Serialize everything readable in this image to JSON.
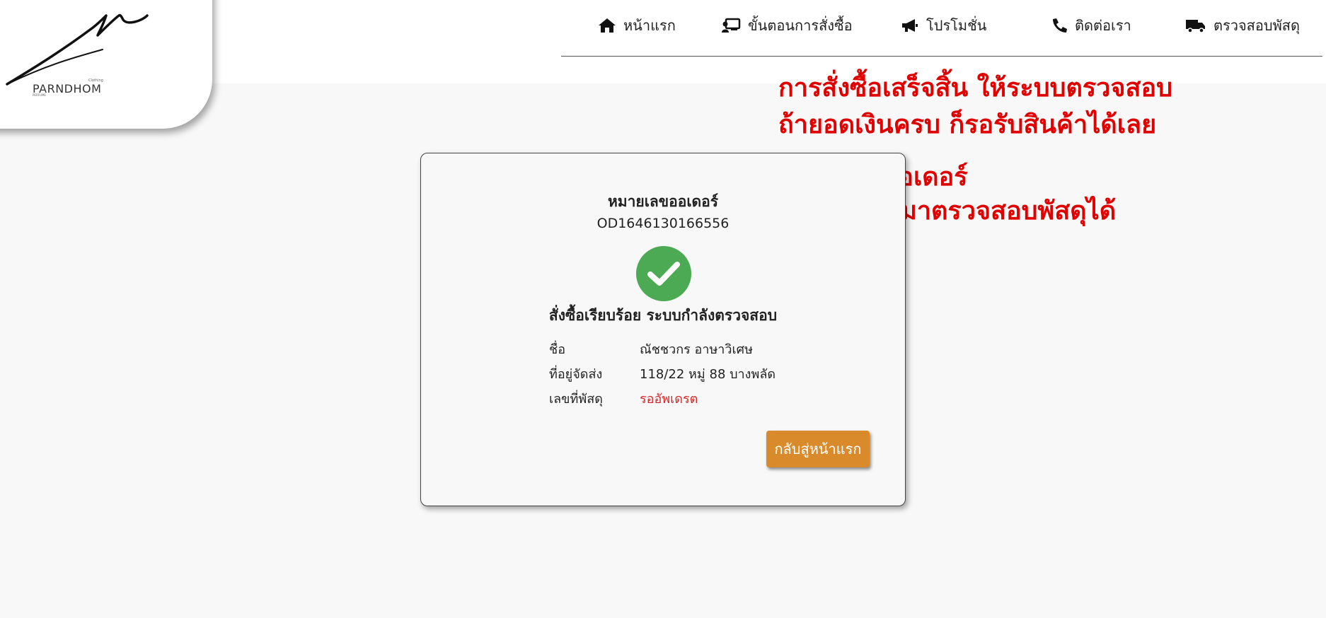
{
  "logo": {
    "brand": "PARNDHOM",
    "tagline_small": "Clothing",
    "sub_small": "PERFUME"
  },
  "nav": {
    "items": [
      {
        "label": "หน้าแรก",
        "icon": "home-icon"
      },
      {
        "label": "ขั้นตอนการสั่งซื้อ",
        "icon": "order-steps-icon"
      },
      {
        "label": "โปรโมชั่น",
        "icon": "megaphone-icon"
      },
      {
        "label": "ติดต่อเรา",
        "icon": "phone-icon"
      },
      {
        "label": "ตรวจสอบพัสดุ",
        "icon": "truck-icon"
      }
    ]
  },
  "annotation": {
    "line1": "การสั่งซื้อเสร็จสิ้น ให้ระบบตรวจสอบ",
    "line2": "ถ้ายอดเงินครบ ก็รอรับสินค้าได้เลย",
    "line3": "หมายเลขออเดอร์",
    "line4": "สามารถนำมาตรวจสอบพัสดุได้",
    "color": "#e00000"
  },
  "order": {
    "label": "หมายเลขออเดอร์",
    "number": "OD1646130166556",
    "status_icon": "check-circle-icon",
    "status_color": "#4caa54",
    "status_text": "สั่งซื้อเรียบร้อย ระบบกำลังตรวจสอบ",
    "details": [
      {
        "label": "ชื่อ",
        "value": "ณัชชวกร อาษาวิเศษ"
      },
      {
        "label": "ที่อยู่จัดส่ง",
        "value": "118/22 หมู่ 88 บางพลัด"
      },
      {
        "label": "เลขที่พัสดุ",
        "value": "รออัพเดรต"
      }
    ],
    "home_button": "กลับสู่หน้าแรก",
    "button_color": "#d98a2b"
  }
}
